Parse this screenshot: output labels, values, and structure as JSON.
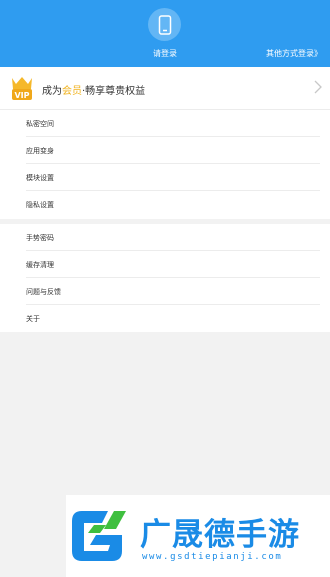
{
  "header": {
    "login_label": "请登录",
    "other_login_label": "其他方式登录》",
    "bg_color": "#2f9cf0",
    "avatar_icon": "phone-icon"
  },
  "vip": {
    "badge_text": "VIP",
    "text_prefix": "成为",
    "text_highlight": "会员",
    "text_suffix": "·畅享尊贵权益",
    "highlight_color": "#f0b21d",
    "chevron_icon": "chevron-right-icon"
  },
  "menu_group_1": [
    {
      "label": "私密空间"
    },
    {
      "label": "应用变身"
    },
    {
      "label": "模块设置"
    },
    {
      "label": "隐私设置"
    }
  ],
  "menu_group_2": [
    {
      "label": "手势密码"
    },
    {
      "label": "缓存清理"
    },
    {
      "label": "问题与反馈"
    },
    {
      "label": "关于"
    }
  ],
  "watermark": {
    "title": "广晟德手游",
    "url": "www.gsdtiepianji.com"
  }
}
